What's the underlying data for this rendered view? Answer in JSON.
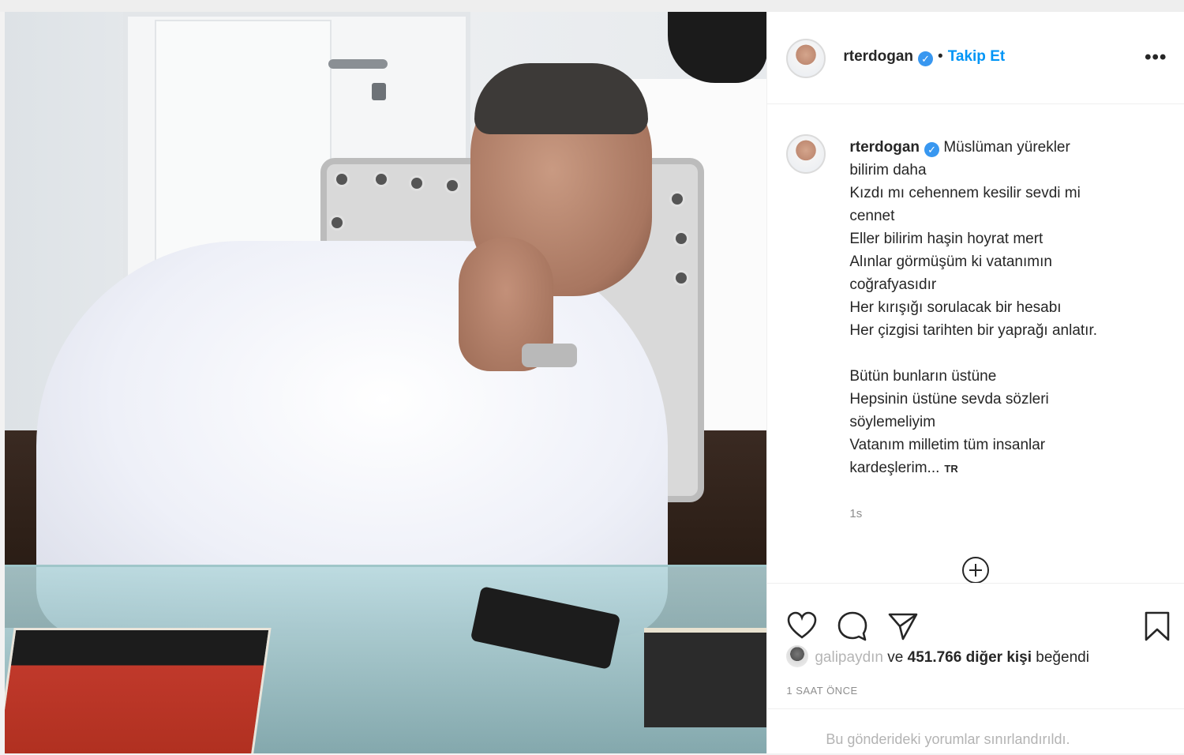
{
  "post": {
    "author": {
      "username": "rterdogan",
      "verified": true,
      "verified_icon": "verified-badge-icon"
    },
    "header": {
      "separator": "•",
      "follow_label": "Takip Et",
      "more_label": "•••"
    },
    "caption": {
      "lines_a": [
        "Müslüman yürekler",
        "bilirim daha",
        "Kızdı mı cehennem kesilir sevdi mi",
        "cennet",
        "Eller bilirim haşin hoyrat mert",
        "Alınlar görmüşüm ki vatanımın",
        "coğrafyasıdır",
        "Her kırışığı sorulacak bir hesabı",
        "Her çizgisi tarihten bir yaprağı anlatır."
      ],
      "lines_b": [
        "Bütün bunların üstüne",
        "Hepsinin üstüne sevda sözleri",
        "söylemeliyim",
        "Vatanım milletim tüm insanlar",
        "kardeşlerim..."
      ],
      "translate_tag": "TR",
      "relative_time": "1s"
    },
    "actions": {
      "like_icon": "heart-icon",
      "comment_icon": "comment-bubble-icon",
      "share_icon": "paper-plane-icon",
      "save_icon": "bookmark-icon",
      "load_more_icon": "plus-circle-icon"
    },
    "likes": {
      "first_liker": "galipaydın",
      "connector": "ve",
      "count_text": "451.766 diğer kişi",
      "suffix": "beğendi"
    },
    "timestamp": "1 SAAT ÖNCE",
    "comments_notice": "Bu gönderideki yorumlar sınırlandırıldı."
  },
  "colors": {
    "link_blue": "#0095f6",
    "verified_blue": "#3897f0",
    "text_primary": "#262626",
    "text_secondary": "#8e8e8e",
    "divider": "#efefef"
  }
}
